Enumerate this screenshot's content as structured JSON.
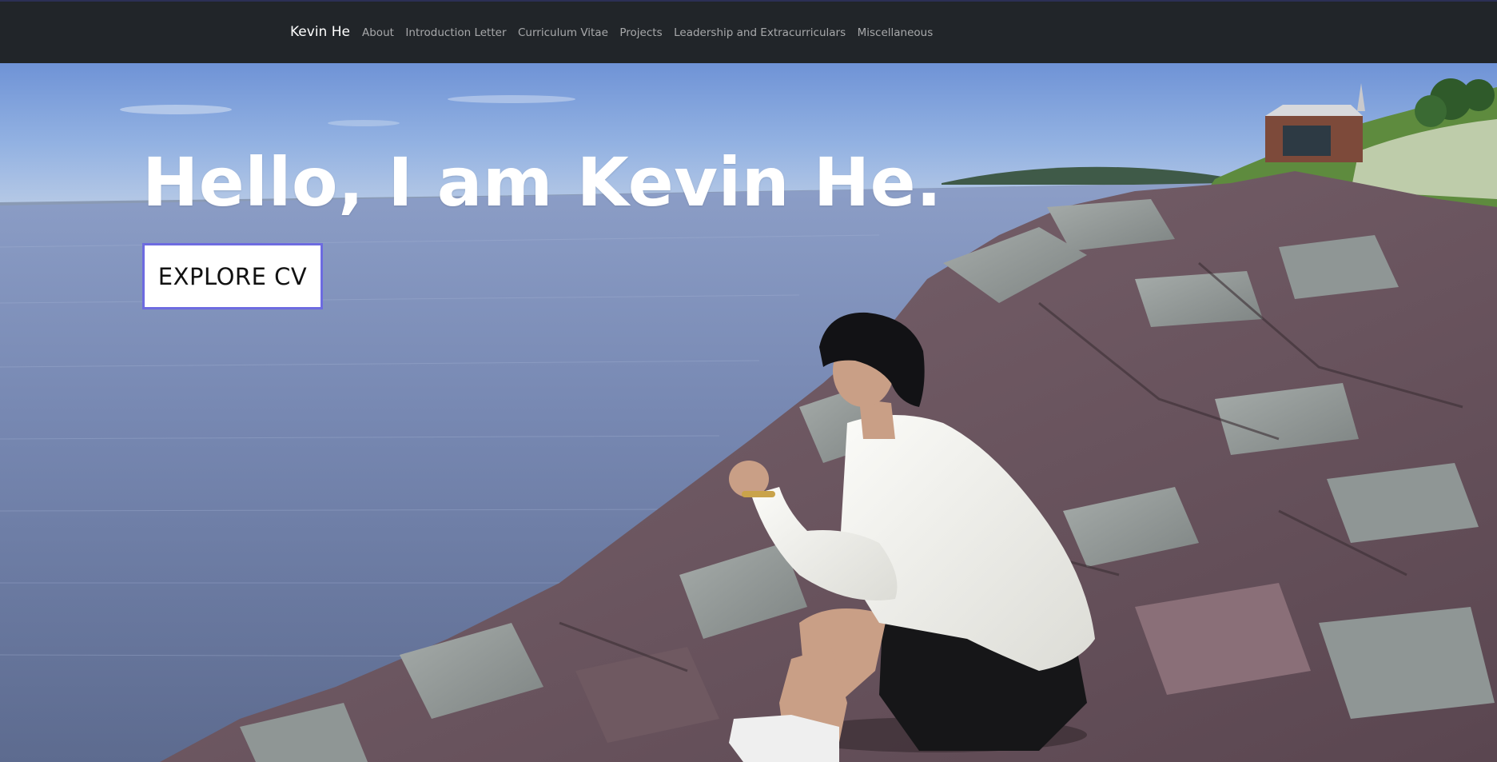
{
  "navbar": {
    "brand": "Kevin He",
    "links": [
      {
        "label": "About"
      },
      {
        "label": "Introduction Letter"
      },
      {
        "label": "Curriculum Vitae"
      },
      {
        "label": "Projects"
      },
      {
        "label": "Leadership and Extracurriculars"
      },
      {
        "label": "Miscellaneous"
      }
    ]
  },
  "hero": {
    "title": "Hello, I am Kevin He.",
    "cta_label": "EXPLORE CV",
    "background_image": "person-sitting-on-coastal-rocks-photo"
  },
  "colors": {
    "navbar_bg": "#212529",
    "nav_link": "rgba(255,255,255,0.6)",
    "cta_border": "#6d6be0"
  }
}
